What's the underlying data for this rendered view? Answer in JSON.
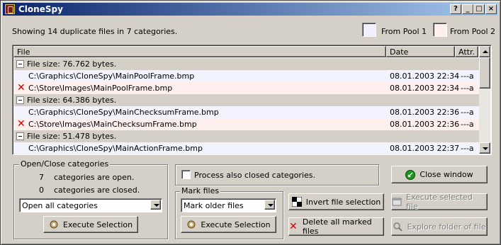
{
  "window": {
    "title": "CloneSpy"
  },
  "summary": "Showing 14 duplicate files in 7 categories.",
  "legend": {
    "pool1": "From Pool 1",
    "pool2": "From Pool 2"
  },
  "colors": {
    "pool1": "#f0f0ff",
    "pool2": "#fff0ee",
    "title_start": "#0a246a",
    "title_end": "#a6caf0",
    "delete": "#d00000"
  },
  "list": {
    "columns": [
      "File",
      "Date",
      "Attr."
    ],
    "rows": [
      {
        "kind": "category",
        "text": "File size:  76.762 bytes."
      },
      {
        "kind": "file",
        "pool": 1,
        "marked": false,
        "path": "C:\\Graphics\\CloneSpy\\MainPoolFrame.bmp",
        "date": "08.01.2003  22:34",
        "attr": "---a"
      },
      {
        "kind": "file",
        "pool": 2,
        "marked": true,
        "path": "C:\\Store\\Images\\MainPoolFrame.bmp",
        "date": "08.01.2003  22:34",
        "attr": "---a"
      },
      {
        "kind": "category",
        "text": "File size:  64.386 bytes."
      },
      {
        "kind": "file",
        "pool": 1,
        "marked": false,
        "path": "C:\\Graphics\\CloneSpy\\MainChecksumFrame.bmp",
        "date": "08.01.2003  22:36",
        "attr": "---a"
      },
      {
        "kind": "file",
        "pool": 2,
        "marked": true,
        "path": "C:\\Store\\Images\\MainChecksumFrame.bmp",
        "date": "08.01.2003  22:36",
        "attr": "---a"
      },
      {
        "kind": "category",
        "text": "File size:  51.478 bytes."
      },
      {
        "kind": "file",
        "pool": 1,
        "marked": false,
        "path": "C:\\Graphics\\CloneSpy\\MainActionFrame.bmp",
        "date": "08.01.2003  22:37",
        "attr": "---a"
      }
    ]
  },
  "open_close": {
    "group_label": "Open/Close categories",
    "open_count": "7",
    "open_label": "categories are open.",
    "closed_count": "0",
    "closed_label": "categories are closed.",
    "combo_value": "Open all categories",
    "execute_label": "Execute Selection"
  },
  "process_closed_label": "Process also closed categories.",
  "mark_files": {
    "group_label": "Mark files",
    "combo_value": "Mark older files",
    "execute_label": "Execute Selection"
  },
  "buttons": {
    "invert": "Invert file selection",
    "delete": "Delete all marked files",
    "close": "Close window",
    "execute_file": "Execute selected file",
    "explore_folder": "Explore folder of file"
  },
  "titlebar_buttons": {
    "help": "?",
    "minimize": "_",
    "maximize": "□",
    "close": "×"
  }
}
